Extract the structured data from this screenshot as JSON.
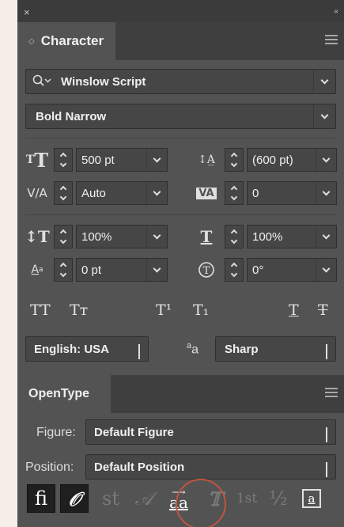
{
  "panel": {
    "titlebar": {
      "close_glyph": "×",
      "collapse_glyph": "‹‹"
    },
    "character": {
      "tab_label": "Character",
      "font": {
        "search_icon": "magnifier-icon",
        "family": "Winslow Script",
        "style": "Bold Narrow"
      },
      "size": "500 pt",
      "leading": "(600 pt)",
      "kerning": "Auto",
      "tracking": "0",
      "vertical_scale": "100%",
      "horizontal_scale": "100%",
      "baseline_shift": "0 pt",
      "rotation": "0°",
      "style_buttons": [
        {
          "name": "all-caps",
          "glyph": "TT"
        },
        {
          "name": "small-caps",
          "glyph": "Tт"
        },
        {
          "name": "superscript",
          "glyph": "T¹"
        },
        {
          "name": "subscript",
          "glyph": "T₁"
        },
        {
          "name": "underline",
          "glyph": "T"
        },
        {
          "name": "strikethrough",
          "glyph": "T"
        }
      ],
      "language": "English: USA",
      "antialias_icon": "aa",
      "antialias": "Sharp"
    },
    "opentype": {
      "tab_label": "OpenType",
      "figure_label": "Figure:",
      "figure_value": "Default Figure",
      "position_label": "Position:",
      "position_value": "Default Position",
      "buttons": [
        {
          "name": "standard-ligatures",
          "glyph": "fi",
          "state": "active"
        },
        {
          "name": "contextual-alternates",
          "glyph": "𝒪",
          "state": "active"
        },
        {
          "name": "discretionary-ligatures",
          "glyph": "st",
          "state": "disabled"
        },
        {
          "name": "swash",
          "glyph": "𝒜",
          "state": "disabled"
        },
        {
          "name": "stylistic-alternates",
          "glyph": "aa",
          "state": "highlighted"
        },
        {
          "name": "titling-alternates",
          "glyph": "𝕋",
          "state": "disabled"
        },
        {
          "name": "ordinals",
          "glyph": "1st",
          "state": "disabled"
        },
        {
          "name": "fractions",
          "glyph": "½",
          "state": "disabled"
        },
        {
          "name": "stylistic-sets",
          "glyph": "a",
          "state": "enabled"
        }
      ],
      "highlight_color": "#c2553e"
    }
  }
}
